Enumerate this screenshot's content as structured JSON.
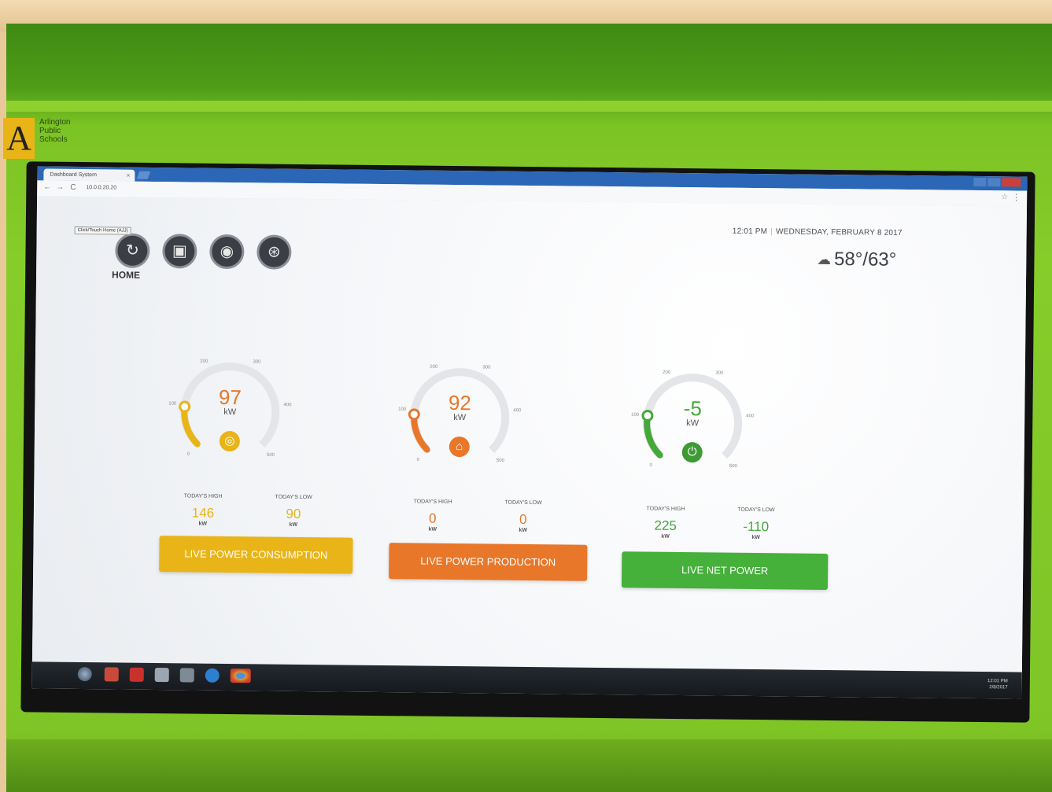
{
  "brand": {
    "logo_letter": "A",
    "line1": "Arlington",
    "line2": "Public",
    "line3": "Schools"
  },
  "browser": {
    "tab_title": "Dashboard System",
    "tab_close": "×",
    "url": "10.0.0.20.20",
    "back": "←",
    "forward": "→",
    "reload": "C",
    "star": "☆",
    "menu": "⋮"
  },
  "nav": {
    "tooltip": "Click/Touch Home (AJJ)",
    "home_label": "HOME",
    "home_glyph": "↻",
    "calendar_glyph": "▣",
    "globe_glyph": "◉",
    "network_glyph": "⊛"
  },
  "header": {
    "time": "12:01 PM",
    "separator": "|",
    "date": "WEDNESDAY, FEBRUARY 8 2017",
    "weather_icon": "cloud-icon",
    "weather_glyph": "☁",
    "temperature": "58°/63°"
  },
  "panels": [
    {
      "value": "97",
      "unit": "kW",
      "color": "#e9b418",
      "badge_glyph": "◎",
      "badge_icon": "sun-icon",
      "high_label": "TODAY'S HIGH",
      "high_value": "146",
      "high_unit": "kW",
      "low_label": "TODAY'S LOW",
      "low_value": "90",
      "low_unit": "kW",
      "button": "LIVE POWER CONSUMPTION",
      "ticks": [
        "0",
        "100",
        "200",
        "300",
        "400",
        "500"
      ],
      "gauge_fraction": 0.19
    },
    {
      "value": "92",
      "unit": "kW",
      "color": "#e8772a",
      "badge_glyph": "⌂",
      "badge_icon": "solar-panel-icon",
      "high_label": "TODAY'S HIGH",
      "high_value": "0",
      "high_unit": "kW",
      "low_label": "TODAY'S LOW",
      "low_value": "0",
      "low_unit": "kW",
      "button": "LIVE POWER PRODUCTION",
      "ticks": [
        "0",
        "100",
        "200",
        "300",
        "400",
        "500"
      ],
      "gauge_fraction": 0.18
    },
    {
      "value": "-5",
      "unit": "kW",
      "color": "#45a83b",
      "badge_glyph": "⏻",
      "badge_icon": "plug-icon",
      "high_label": "TODAY'S HIGH",
      "high_value": "225",
      "high_unit": "kW",
      "low_label": "TODAY'S LOW",
      "low_value": "-110",
      "low_unit": "kW",
      "button": "LIVE NET POWER",
      "ticks": [
        "0",
        "100",
        "200",
        "300",
        "400",
        "500"
      ],
      "gauge_fraction": 0.2
    }
  ],
  "taskbar": {
    "clock_time": "12:01 PM",
    "clock_date": "2/8/2017"
  }
}
